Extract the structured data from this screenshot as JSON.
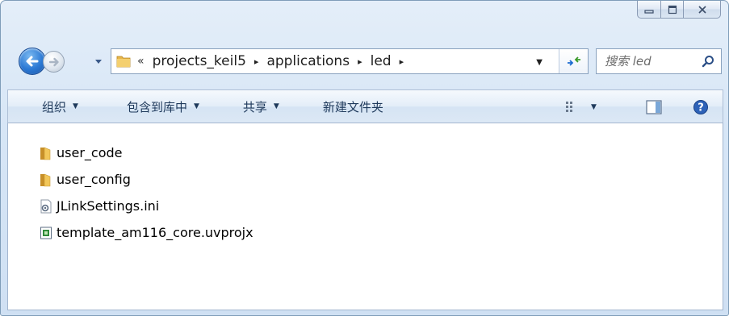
{
  "window": {
    "caption": {
      "minimize_icon": "minimize-icon",
      "maximize_icon": "maximize-icon",
      "close_icon": "close-icon"
    }
  },
  "nav": {
    "back_icon": "back-arrow-icon",
    "forward_icon": "forward-arrow-icon",
    "recent_icon": "dropdown-triangle-icon"
  },
  "address": {
    "overflow": "«",
    "breadcrumbs": [
      "projects_keil5",
      "applications",
      "led"
    ],
    "separator": "▸"
  },
  "search": {
    "placeholder": "搜索 led"
  },
  "toolbar": {
    "organize_label": "组织",
    "include_label": "包含到库中",
    "share_label": "共享",
    "new_folder_label": "新建文件夹",
    "dropdown_glyph": "▼"
  },
  "files": [
    {
      "name": "user_code",
      "icon": "folder-icon"
    },
    {
      "name": "user_config",
      "icon": "folder-icon"
    },
    {
      "name": "JLinkSettings.ini",
      "icon": "settings-file-icon"
    },
    {
      "name": "template_am116_core.uvprojx",
      "icon": "project-file-icon"
    }
  ],
  "colors": {
    "accent": "#1e395b",
    "folder": "#e8b64a",
    "border": "#8aa2bf"
  }
}
